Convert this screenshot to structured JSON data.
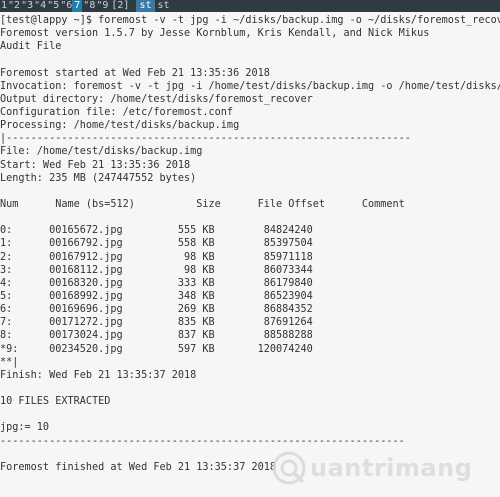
{
  "tabbar": {
    "tabs": [
      "1",
      "\"2",
      "\"3",
      "\"4",
      "\"5",
      "\"6"
    ],
    "active": "7",
    "after": [
      "\"8",
      "\"9",
      "[2]"
    ],
    "session_tabs": [
      "st",
      "st"
    ]
  },
  "terminal": {
    "lines": [
      "[test@lappy ~]$ foremost -v -t jpg -i ~/disks/backup.img -o ~/disks/foremost_recover/",
      "Foremost version 1.5.7 by Jesse Kornblum, Kris Kendall, and Nick Mikus",
      "Audit File",
      "",
      "Foremost started at Wed Feb 21 13:35:36 2018",
      "Invocation: foremost -v -t jpg -i /home/test/disks/backup.img -o /home/test/disks/foremost_recover",
      "Output directory: /home/test/disks/foremost_recover",
      "Configuration file: /etc/foremost.conf",
      "Processing: /home/test/disks/backup.img",
      "|------------------------------------------------------------------",
      "File: /home/test/disks/backup.img",
      "Start: Wed Feb 21 13:35:36 2018",
      "Length: 235 MB (247447552 bytes)",
      "",
      "Num      Name (bs=512)          Size      File Offset      Comment",
      "",
      "0:      00165672.jpg         555 KB        84824240",
      "1:      00166792.jpg         558 KB        85397504",
      "2:      00167912.jpg          98 KB        85971118",
      "3:      00168112.jpg          98 KB        86073344",
      "4:      00168320.jpg         333 KB        86179840",
      "5:      00168992.jpg         348 KB        86523904",
      "6:      00169696.jpg         269 KB        86884352",
      "7:      00171272.jpg         835 KB        87691264",
      "8:      00173024.jpg         837 KB        88588288",
      "*9:     00234520.jpg         597 KB       120074240",
      "**|",
      "Finish: Wed Feb 21 13:35:37 2018",
      "",
      "10 FILES EXTRACTED",
      "",
      "jpg:= 10",
      "------------------------------------------------------------------",
      "",
      "Foremost finished at Wed Feb 21 13:35:37 2018"
    ]
  },
  "watermark": {
    "text": "uantrimang"
  }
}
